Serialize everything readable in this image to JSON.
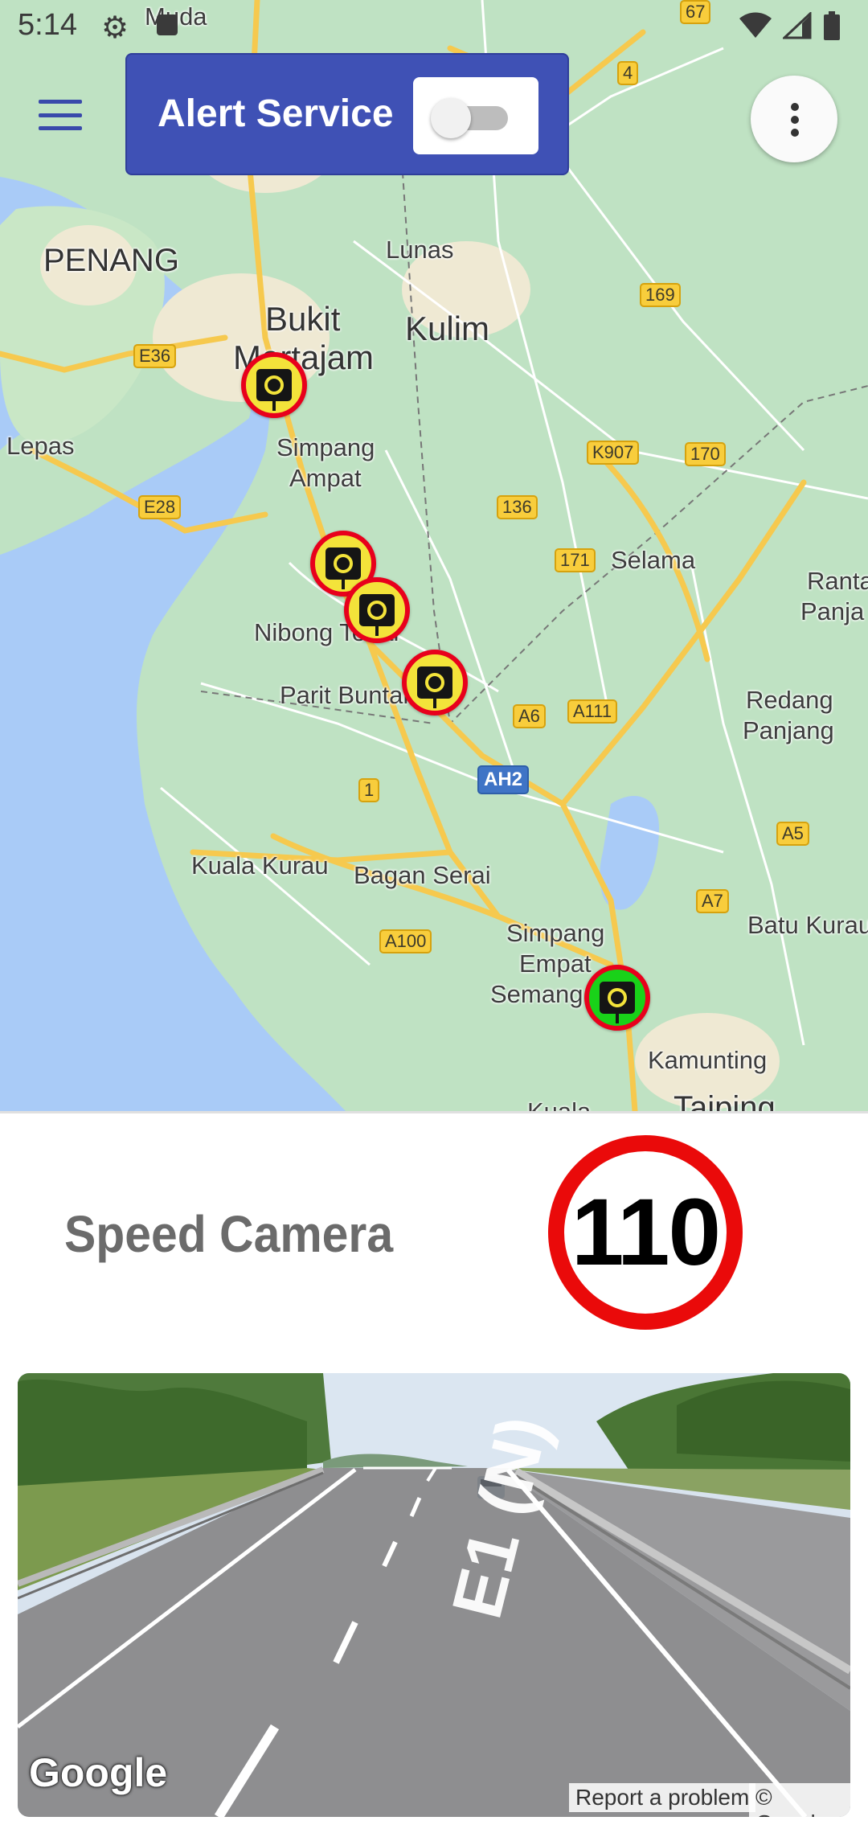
{
  "status_bar": {
    "time": "5:14",
    "icons": [
      "gear-icon",
      "notification-square-icon",
      "wifi-icon",
      "signal-icon",
      "battery-icon"
    ]
  },
  "header": {
    "menu_icon": "hamburger-menu-icon",
    "alert_title": "Alert Service",
    "alert_toggle_on": false,
    "overflow_icon": "more-vert-icon"
  },
  "map": {
    "places": {
      "muda": "Muda",
      "penang": "PENANG",
      "lunas": "Lunas",
      "bukit": "Bukit",
      "mertajam": "Mertajam",
      "kulim": "Kulim",
      "lepas": "Lepas",
      "simpang_ampat_1": "Simpang",
      "simpang_ampat_2": "Ampat",
      "selama": "Selama",
      "ranta": "Ranta",
      "panja": "Panja",
      "nibong_tebal": "Nibong Tebal",
      "parit_buntar": "Parit Buntar",
      "redang_1": "Redang",
      "redang_2": "Panjang",
      "kuala_kurau": "Kuala Kurau",
      "bagan_serai": "Bagan Serai",
      "simpang_empat_1": "Simpang",
      "simpang_empat_2": "Empat",
      "simpang_empat_3": "Semang",
      "batu_kurau": "Batu Kurau",
      "kamunting": "Kamunting",
      "taiping": "Taiping",
      "kuala": "Kuala"
    },
    "shields": {
      "r67": "67",
      "r4": "4",
      "r169": "169",
      "e36": "E36",
      "k907": "K907",
      "r170": "170",
      "e28": "E28",
      "r136": "136",
      "r171": "171",
      "a6": "A6",
      "a111": "A111",
      "ah2": "AH2",
      "r1": "1",
      "a5": "A5",
      "a7": "A7",
      "a100": "A100"
    },
    "camera_markers": [
      {
        "type": "speed-camera",
        "state": "default",
        "ring": "#e8001c",
        "fill": "#f3e33a"
      },
      {
        "type": "speed-camera",
        "state": "default",
        "ring": "#e8001c",
        "fill": "#f3e33a"
      },
      {
        "type": "speed-camera",
        "state": "default",
        "ring": "#e8001c",
        "fill": "#f3e33a"
      },
      {
        "type": "speed-camera",
        "state": "default",
        "ring": "#e8001c",
        "fill": "#f3e33a"
      },
      {
        "type": "speed-camera",
        "state": "selected",
        "ring": "#e8001c",
        "fill": "#19d219"
      }
    ]
  },
  "info": {
    "camera_type": "Speed Camera",
    "speed_limit": "110"
  },
  "street_view": {
    "road_marking": "E1 (N)",
    "logo": "Google",
    "report_link": "Report a problem",
    "copyright": "© Google"
  },
  "colors": {
    "primary": "#3f51b5",
    "map_water": "#a9cbf7",
    "map_land": "#bfe2c3",
    "road_major": "#f6c94e",
    "marker_ring": "#e8001c",
    "speed_sign_ring": "#ea0a0a"
  }
}
